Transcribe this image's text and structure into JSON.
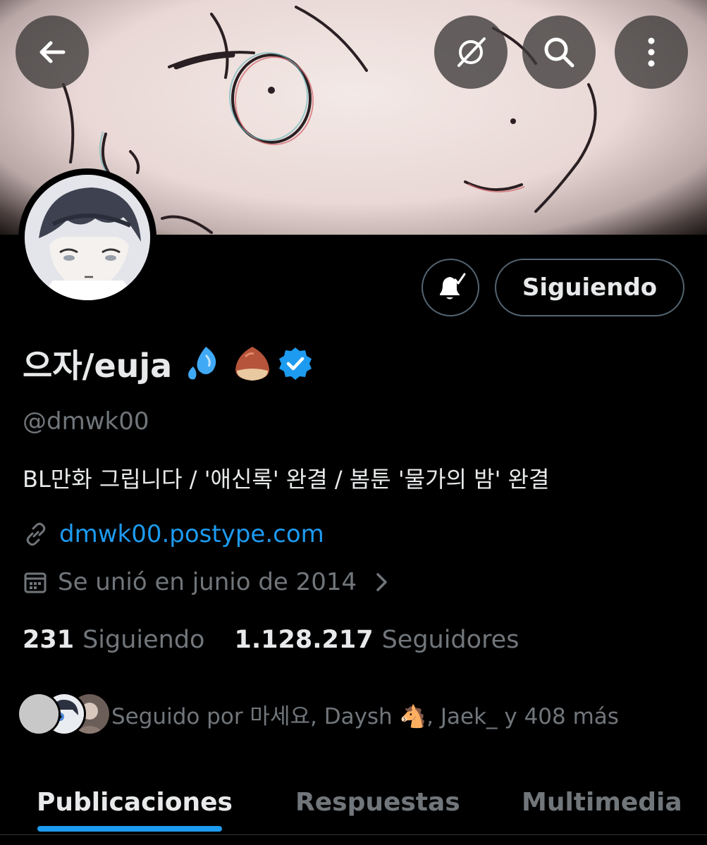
{
  "header": {
    "back_icon": "arrow-left-icon",
    "grok_icon": "grok-icon",
    "search_icon": "search-icon",
    "more_icon": "more-vertical-icon"
  },
  "profile": {
    "display_name": "으자/euja",
    "name_emojis": [
      "💦",
      "🌰"
    ],
    "verified_icon": "verified-badge-icon",
    "handle": "@dmwk00",
    "bio": "BL만화 그립니다 / '애신록' 완결 / 봄툰 '물가의 밤' 완결",
    "link": "dmwk00.postype.com",
    "joined": "Se unió en junio de 2014",
    "notifications_icon": "bell-check-icon",
    "follow_button_label": "Siguiendo"
  },
  "stats": {
    "following_count": "231",
    "following_label": "Siguiendo",
    "followers_count": "1.128.217",
    "followers_label": "Seguidores"
  },
  "followed_by": {
    "text": "Seguido por 마세요, Daysh 🐴, Jaek_ y 408 más"
  },
  "tabs": [
    {
      "label": "Publicaciones",
      "active": true
    },
    {
      "label": "Respuestas",
      "active": false
    },
    {
      "label": "Multimedia",
      "active": false
    }
  ],
  "colors": {
    "accent": "#1d9bf0",
    "background": "#000000",
    "secondary_text": "#71767b",
    "border": "#536471"
  }
}
